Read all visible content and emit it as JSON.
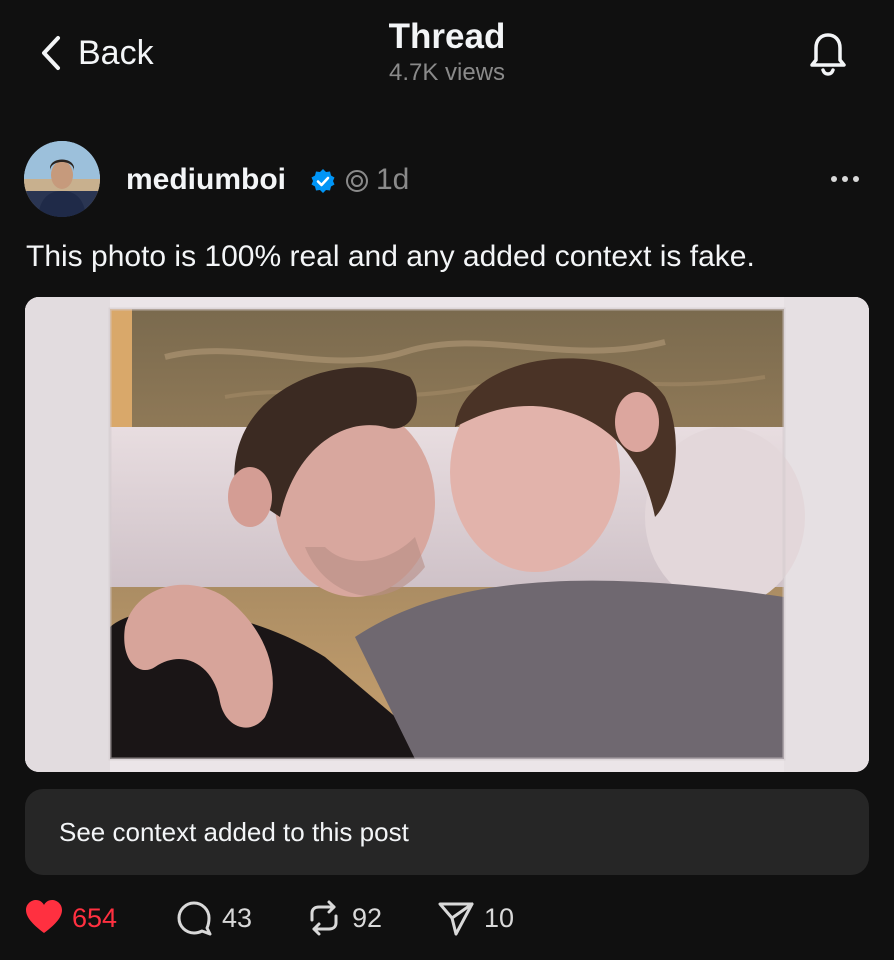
{
  "header": {
    "back_label": "Back",
    "title": "Thread",
    "views": "4.7K views",
    "back_icon": "chevron-left-icon",
    "bell_icon": "bell-icon"
  },
  "post": {
    "username": "mediumboi",
    "time": "1d",
    "text": "This photo is 100% real and any added context is fake.",
    "context_label": "See context added to this post",
    "verified_color": "#0095f6"
  },
  "actions": {
    "likes": "654",
    "replies": "43",
    "reposts": "92",
    "shares": "10",
    "like_color": "#ff3040"
  }
}
